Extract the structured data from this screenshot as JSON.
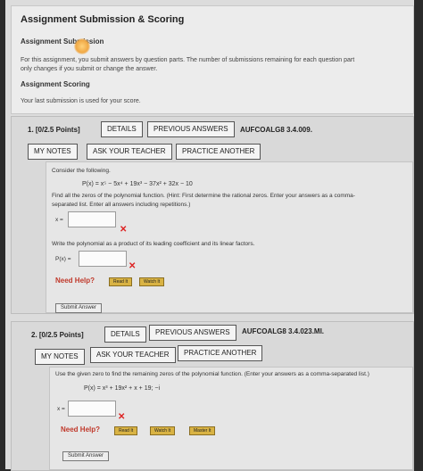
{
  "header": {
    "title": "Assignment Submission & Scoring",
    "submission_heading": "Assignment Submission",
    "submission_desc_line1": "For this assignment, you submit answers by question parts. The number of submissions remaining for each question part",
    "submission_desc_line2": "only changes if you submit or change the answer.",
    "scoring_heading": "Assignment Scoring",
    "scoring_desc": "Your last submission is used for your score."
  },
  "q1": {
    "number": "1.  [0/2.5 Points]",
    "details": "DETAILS",
    "previous": "PREVIOUS ANSWERS",
    "code": "AUFCOALG8 3.4.009.",
    "notes": "MY NOTES",
    "ask": "ASK YOUR TEACHER",
    "practice": "PRACTICE ANOTHER",
    "consider": "Consider the following.",
    "poly": "P(x) = x⁵ − 5x⁴ + 19x³ − 37x² + 32x − 10",
    "instr1": "Find all the zeros of the polynomial function. (Hint: First determine the rational zeros. Enter your answers as a comma-",
    "instr2": "separated list. Enter all answers including repetitions.)",
    "x_label": "x =",
    "write_instr": "Write the polynomial as a product of its leading coefficient and its linear factors.",
    "px_label": "P(x) =",
    "need_help": "Need Help?",
    "read_it": "Read It",
    "watch_it": "Watch It",
    "submit": "Submit Answer"
  },
  "q2": {
    "number": "2.  [0/2.5 Points]",
    "details": "DETAILS",
    "previous": "PREVIOUS ANSWERS",
    "code": "AUFCOALG8 3.4.023.MI.",
    "notes": "MY NOTES",
    "ask": "ASK YOUR TEACHER",
    "practice": "PRACTICE ANOTHER",
    "instr": "Use the given zero to find the remaining zeros of the polynomial function. (Enter your answers as a comma-separated list.)",
    "poly": "P(x) = x³ + 19x² + x + 19;     −i",
    "x_label": "x =",
    "need_help": "Need Help?",
    "read_it": "Read It",
    "watch_it": "Watch It",
    "master_it": "Master It",
    "submit": "Submit Answer"
  },
  "colors": {
    "incorrect": "#d22222",
    "need_help": "#c0392b",
    "help_button": "#d9b344"
  }
}
